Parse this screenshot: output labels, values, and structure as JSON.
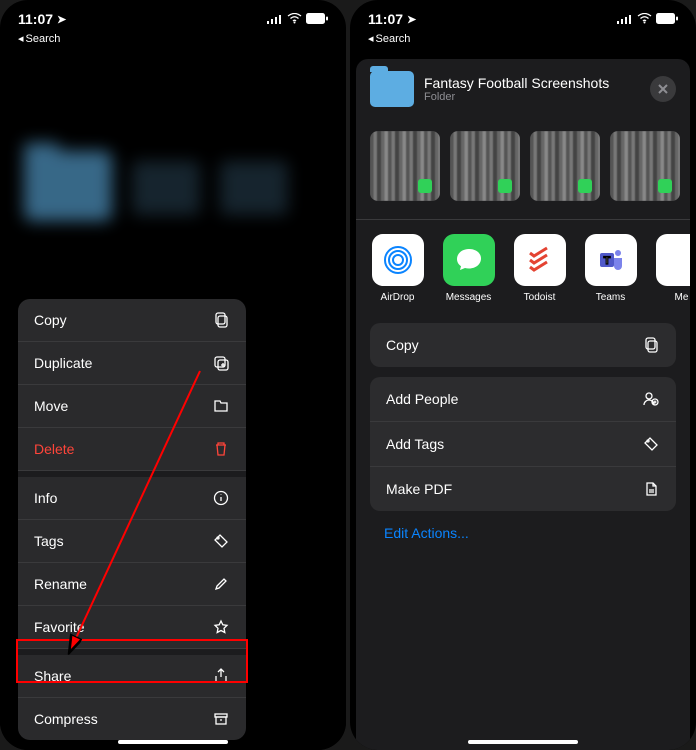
{
  "status": {
    "time": "11:07",
    "back_label": "Search"
  },
  "left": {
    "menu": {
      "copy": "Copy",
      "duplicate": "Duplicate",
      "move": "Move",
      "delete": "Delete",
      "info": "Info",
      "tags": "Tags",
      "rename": "Rename",
      "favorite": "Favorite",
      "share": "Share",
      "compress": "Compress"
    }
  },
  "right": {
    "header": {
      "title": "Fantasy Football Screenshots",
      "subtitle": "Folder"
    },
    "apps": {
      "airdrop": "AirDrop",
      "messages": "Messages",
      "todoist": "Todoist",
      "teams": "Teams",
      "more": "Me"
    },
    "actions": {
      "copy": "Copy",
      "add_people": "Add People",
      "add_tags": "Add Tags",
      "make_pdf": "Make PDF",
      "edit": "Edit Actions..."
    }
  }
}
